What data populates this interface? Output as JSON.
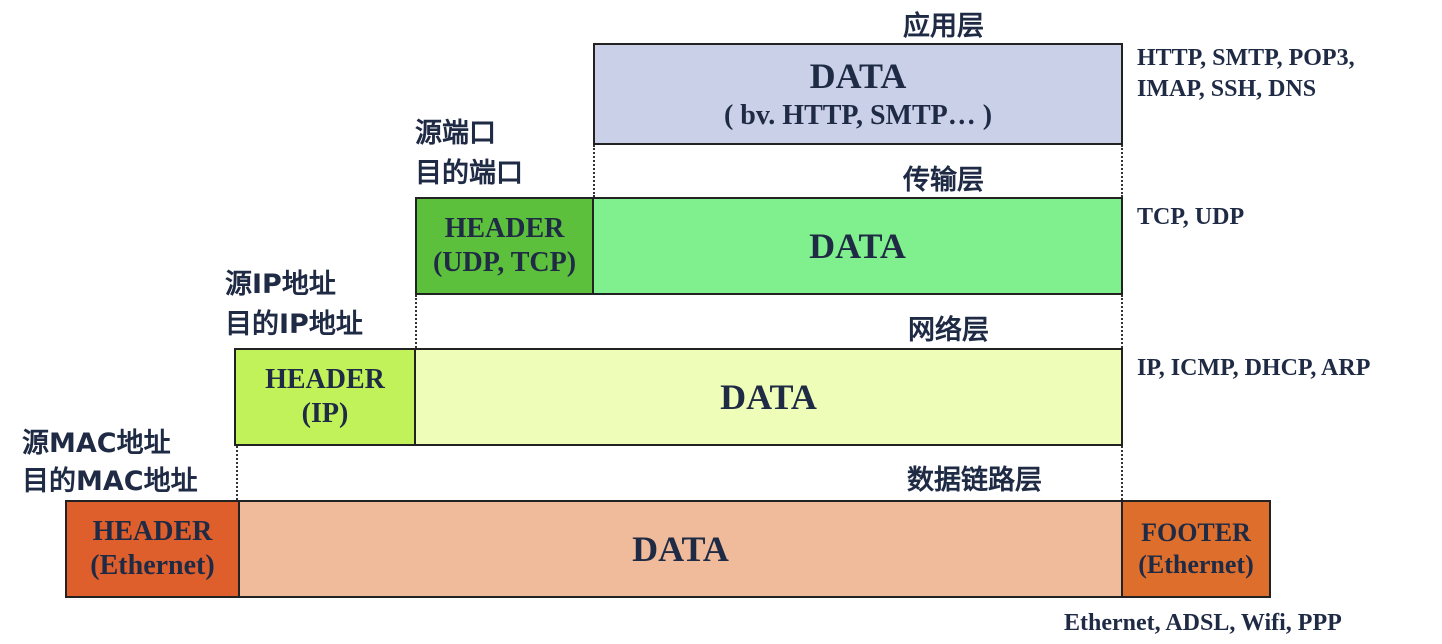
{
  "layers": {
    "application": {
      "title": "应用层",
      "data_label": "DATA",
      "data_sub": "( bv. HTTP, SMTP… )",
      "protocols_line1": "HTTP, SMTP, POP3,",
      "protocols_line2": "IMAP, SSH, DNS"
    },
    "transport": {
      "title": "传输层",
      "side_line1": "源端口",
      "side_line2": "目的端口",
      "header_line1": "HEADER",
      "header_line2": "(UDP, TCP)",
      "data_label": "DATA",
      "protocols": "TCP, UDP"
    },
    "network": {
      "title": "网络层",
      "side_line1": "源IP地址",
      "side_line2": "目的IP地址",
      "header_line1": "HEADER",
      "header_line2": "(IP)",
      "data_label": "DATA",
      "protocols": "IP, ICMP, DHCP, ARP"
    },
    "datalink": {
      "title": "数据链路层",
      "side_line1": "源MAC地址",
      "side_line2": "目的MAC地址",
      "header_line1": "HEADER",
      "header_line2": "(Ethernet)",
      "data_label": "DATA",
      "footer_line1": "FOOTER",
      "footer_line2": "(Ethernet)",
      "protocols": "Ethernet, ADSL, Wifi, PPP"
    }
  },
  "colors": {
    "application_data": "#c9d0e8",
    "transport_header": "#5cc03c",
    "transport_data": "#80f08e",
    "network_header": "#c2f25a",
    "network_data": "#eefdb8",
    "datalink_header": "#de5e2c",
    "datalink_data": "#efbb9b",
    "datalink_footer": "#de6e2c",
    "text": "#1f2a44"
  }
}
